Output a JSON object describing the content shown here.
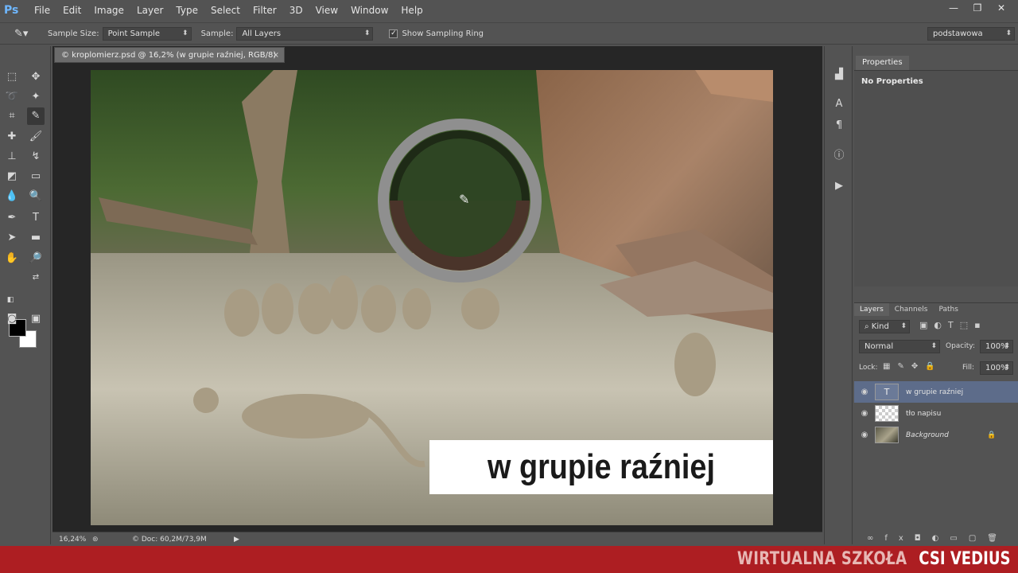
{
  "app": {
    "logo": "Ps"
  },
  "menu": [
    "File",
    "Edit",
    "Image",
    "Layer",
    "Type",
    "Select",
    "Filter",
    "3D",
    "View",
    "Window",
    "Help"
  ],
  "window_controls": [
    "—",
    "❐",
    "✕"
  ],
  "options": {
    "sample_size_label": "Sample Size:",
    "sample_size_value": "Point Sample",
    "sample_label": "Sample:",
    "sample_value": "All Layers",
    "sampling_ring_label": "Show Sampling Ring",
    "sampling_ring_checked": true,
    "workspace": "podstawowa"
  },
  "document": {
    "tab_title": "© kroplomierz.psd @ 16,2% (w grupie raźniej, RGB/8)",
    "caption": "w grupie raźniej"
  },
  "status": {
    "zoom": "16,24%",
    "doc_size": "© Doc: 60,2M/73,9M"
  },
  "properties": {
    "tab": "Properties",
    "empty_text": "No Properties"
  },
  "layers": {
    "tabs": [
      "Layers",
      "Channels",
      "Paths"
    ],
    "filter": "Kind",
    "blend_mode": "Normal",
    "opacity_label": "Opacity:",
    "opacity": "100%",
    "lock_label": "Lock:",
    "fill_label": "Fill:",
    "fill": "100%",
    "items": [
      {
        "name": "w grupie raźniej",
        "kind": "text",
        "selected": true
      },
      {
        "name": "tło napisu",
        "kind": "pixel",
        "selected": false
      },
      {
        "name": "Background",
        "kind": "background",
        "selected": false
      }
    ]
  },
  "banner": {
    "school": "WIRTUALNA SZKOŁA",
    "brand": "CSI VEDIUS"
  },
  "colors": {
    "foreground": "#000000",
    "background": "#ffffff",
    "banner": "#ad1e22",
    "selection": "#5d6c8a"
  }
}
